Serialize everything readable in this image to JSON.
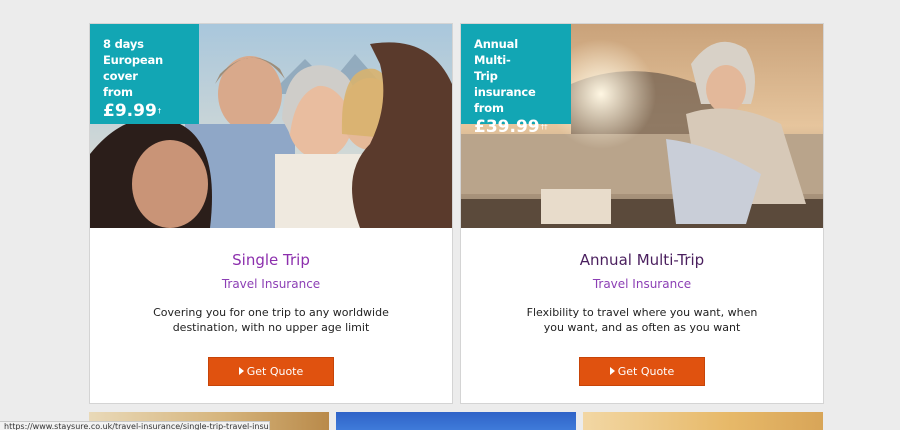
{
  "cards": [
    {
      "badge": {
        "line1": "8 days",
        "line2": "European cover",
        "line3": "from",
        "price": "£9.99",
        "mark": "†"
      },
      "title": "Single Trip",
      "subtitle": "Travel Insurance",
      "description": "Covering you for one trip to any worldwide destination, with no upper age limit",
      "button_label": "Get Quote"
    },
    {
      "badge": {
        "line1": "Annual Multi-",
        "line2": "Trip insurance",
        "line3": "from",
        "price": "£39.99",
        "mark": "††"
      },
      "title": "Annual Multi-Trip",
      "subtitle": "Travel Insurance",
      "description": "Flexibility to travel where you want, when you want, and as often as you want",
      "button_label": "Get Quote"
    }
  ],
  "statusbar": {
    "url": "https://www.staysure.co.uk/travel-insurance/single-trip-travel-insurance/"
  },
  "colors": {
    "badge_teal": "#12a6b4",
    "button_orange": "#e0520f",
    "title_purple": "#8c2fad",
    "title_dark_purple": "#4a1f5e"
  },
  "icons": {
    "button": "caret-right-icon"
  }
}
